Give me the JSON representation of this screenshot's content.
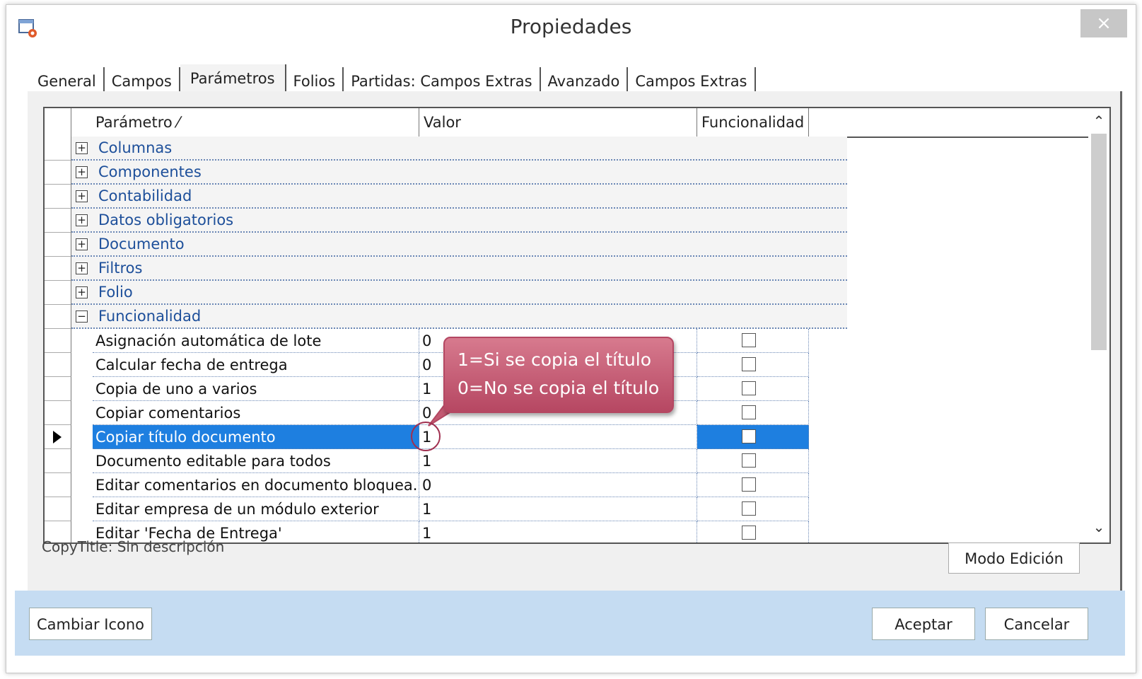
{
  "window": {
    "title": "Propiedades",
    "close_label": "×"
  },
  "tabs": [
    {
      "label": "General"
    },
    {
      "label": "Campos"
    },
    {
      "label": "Parámetros"
    },
    {
      "label": "Folios"
    },
    {
      "label": "Partidas: Campos Extras"
    },
    {
      "label": "Avanzado"
    },
    {
      "label": "Campos Extras"
    }
  ],
  "active_tab": "Parámetros",
  "grid": {
    "headers": {
      "parametro": "Parámetro ⁄",
      "valor": "Valor",
      "funcionalidad": "Funcionalidad"
    },
    "groups": [
      {
        "expander": "+",
        "label": "Columnas"
      },
      {
        "expander": "+",
        "label": "Componentes"
      },
      {
        "expander": "+",
        "label": "Contabilidad"
      },
      {
        "expander": "+",
        "label": "Datos obligatorios"
      },
      {
        "expander": "+",
        "label": "Documento"
      },
      {
        "expander": "+",
        "label": "Filtros"
      },
      {
        "expander": "+",
        "label": "Folio"
      },
      {
        "expander": "−",
        "label": "Funcionalidad"
      }
    ],
    "rows": [
      {
        "name": "Asignación automática de lote",
        "value": "0",
        "checked": false
      },
      {
        "name": "Calcular fecha de entrega",
        "value": "0",
        "checked": false
      },
      {
        "name": "Copia de uno a varios",
        "value": "1",
        "checked": false
      },
      {
        "name": "Copiar comentarios",
        "value": "0",
        "checked": false
      },
      {
        "name": "Copiar título documento",
        "value": "1",
        "checked": false,
        "selected": true
      },
      {
        "name": "Documento editable para todos",
        "value": "1",
        "checked": false
      },
      {
        "name": "Editar comentarios en documento bloquea...",
        "value": "0",
        "checked": false
      },
      {
        "name": "Editar empresa de un módulo exterior",
        "value": "1",
        "checked": false
      },
      {
        "name": "Editar 'Fecha de Entrega'",
        "value": "1",
        "checked": false
      }
    ]
  },
  "description": "CopyTitle: Sin descripción",
  "modo_edicion_label": "Modo Edición",
  "callout": {
    "line1": "1=Si se copia el título",
    "line2": "0=No se copia el título"
  },
  "footer": {
    "cambiar_icono": "Cambiar Icono",
    "aceptar": "Aceptar",
    "cancelar": "Cancelar"
  },
  "colors": {
    "selection": "#1e7fe0",
    "group_text": "#1d4f9a",
    "footer_bg": "#c5dcf2",
    "callout": "#c25a72"
  }
}
